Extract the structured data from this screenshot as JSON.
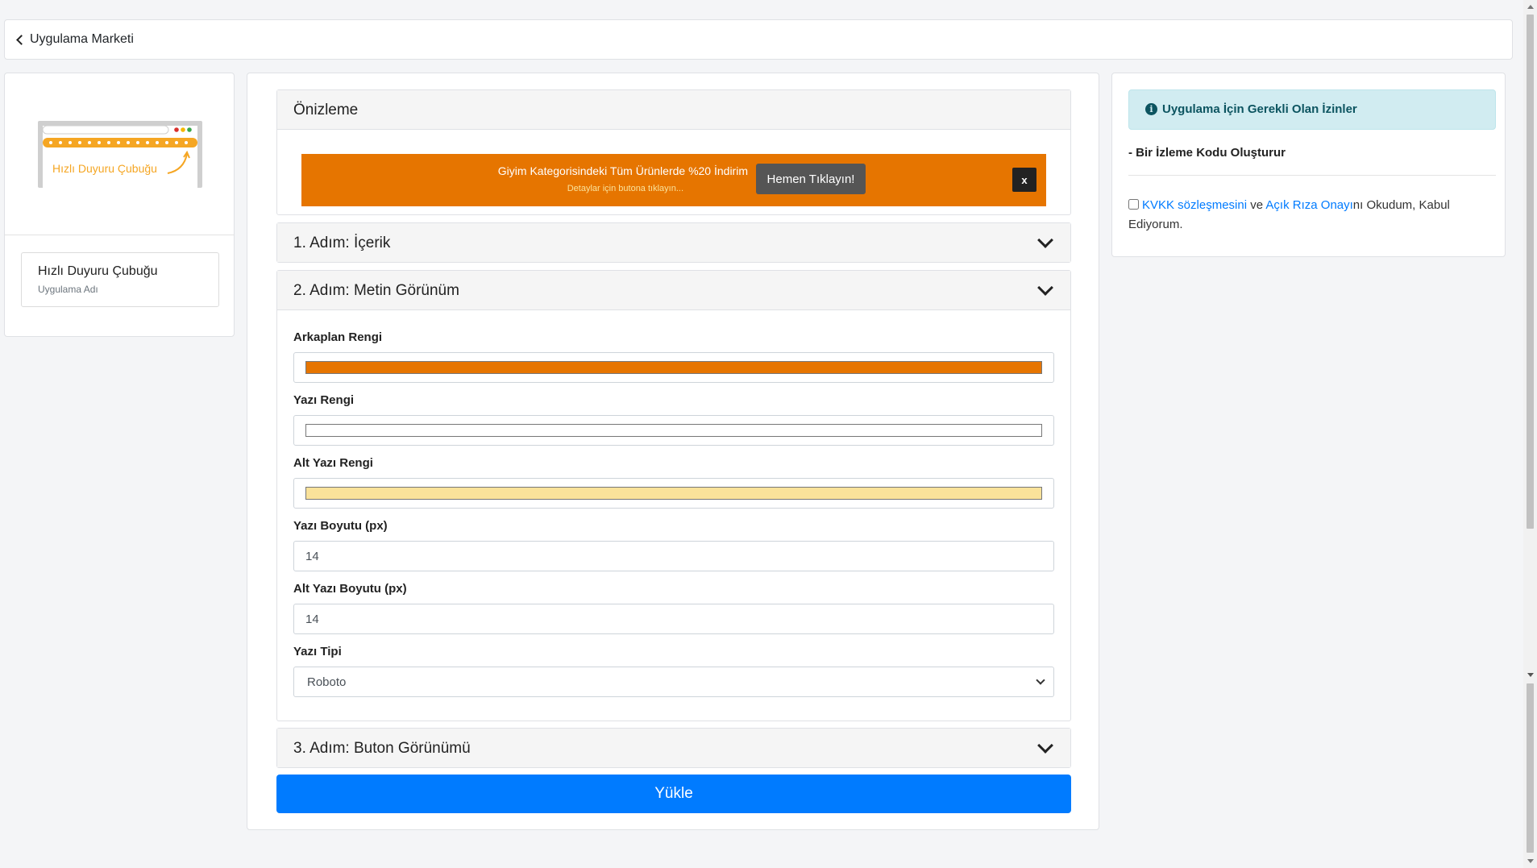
{
  "topbar": {
    "back_label": "Uygulama Marketi"
  },
  "app": {
    "thumbnail_text": "Hızlı Duyuru Çubuğu",
    "name": "Hızlı Duyuru Çubuğu",
    "name_caption": "Uygulama Adı"
  },
  "preview": {
    "title": "Önizleme",
    "banner": {
      "text": "Giyim Kategorisindeki Tüm Ürünlerde %20 İndirim",
      "subtext": "Detaylar için butona tıklayın...",
      "button_label": "Hemen Tıklayın!",
      "close_label": "x",
      "background_color": "#e67500",
      "text_color": "#ffffff",
      "subtext_color": "#fae29a",
      "button_color": "#555555"
    }
  },
  "steps": [
    {
      "title": "1. Adım: İçerik",
      "expanded": false
    },
    {
      "title": "2. Adım: Metin Görünüm",
      "expanded": true
    },
    {
      "title": "3. Adım: Buton Görünümü",
      "expanded": false
    }
  ],
  "text_appearance": {
    "bg_color_label": "Arkaplan Rengi",
    "bg_color_value": "#e67500",
    "text_color_label": "Yazı Rengi",
    "text_color_value": "#ffffff",
    "subtext_color_label": "Alt Yazı Rengi",
    "subtext_color_value": "#fae29a",
    "font_size_label": "Yazı Boyutu (px)",
    "font_size_value": "14",
    "sub_font_size_label": "Alt Yazı Boyutu (px)",
    "sub_font_size_value": "14",
    "font_type_label": "Yazı Tipi",
    "font_type_value": "Roboto"
  },
  "submit_label": "Yükle",
  "permissions": {
    "title": "Uygulama İçin Gerekli Olan İzinler",
    "items": [
      "- Bir İzleme Kodu Oluşturur"
    ],
    "consent": {
      "link1": "KVKK sözleşmesini",
      "middle": " ve ",
      "link2": "Açık Rıza Onayı",
      "suffix": "nı Okudum, Kabul Ediyorum."
    }
  },
  "colors": {
    "primary": "#007bff",
    "alert_bg": "#d1ecf1",
    "alert_text": "#0c5460"
  }
}
